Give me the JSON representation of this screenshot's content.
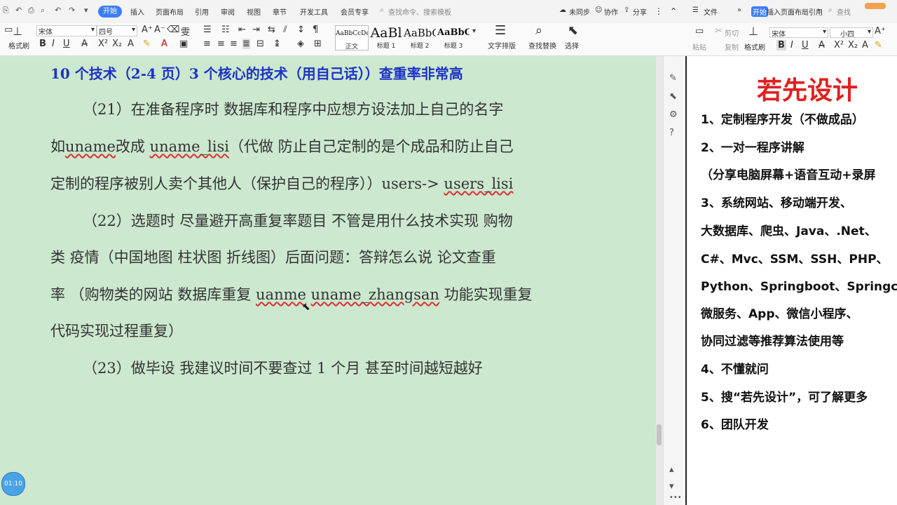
{
  "left_window": {
    "quick_access": [
      "⎘",
      "↶",
      "⎙",
      "⌕",
      "↶",
      "↷",
      "▾"
    ],
    "active_tab": "开始",
    "menu_tabs": [
      "插入",
      "页面布局",
      "引用",
      "审阅",
      "视图",
      "章节",
      "开发工具",
      "会员专享"
    ],
    "search_placeholder": "查找命令、搜索模板",
    "right_actions": [
      "未同步",
      "协作",
      "分享"
    ],
    "font_name": "宋体",
    "font_size": "四号",
    "format_painter": "格式刷",
    "styles": [
      {
        "preview": "AaBbCcDd",
        "label": "正文"
      },
      {
        "preview": "AaBl",
        "label": "标题 1"
      },
      {
        "preview": "AaBbC",
        "label": "标题 2"
      },
      {
        "preview": "AaBbC",
        "label": "标题 3"
      }
    ],
    "text_layout": "文字排版",
    "find_replace": "查找替换",
    "select": "选择",
    "timer": "01:10"
  },
  "document": {
    "heading": "10 个技术（2-4 页）3 个核心的技术（用自己话））查重率非常高",
    "l1": "（21）在准备程序时 数据库和程序中应想方设法加上自己的名字",
    "l2a": "如",
    "l2b": "uname",
    "l2c": "改成 ",
    "l2d": "uname_lisi",
    "l2e": "（代做 防止自己定制的是个成品和防止自己",
    "l3a": "定制的程序被别人卖个其他人（保护自己的程序））users-> ",
    "l3b": "users_lisi",
    "l4": "（22）选题时 尽量避开高重复率题目 不管是用什么技术实现 购物",
    "l5": "类 疫情（中国地图 柱状图 折线图）后面问题：答辩怎么说 论文查重",
    "l6a": "率 （购物类的网站 数据库重复 ",
    "l6b": "uanme",
    "l6c": " ",
    "l6d": "uname_zhangsan",
    "l6e": " 功能实现重复",
    "l7": "代码实现过程重复）",
    "l8": "（23）做毕设 我建议时间不要查过 1 个月 甚至时间越短越好"
  },
  "right_window": {
    "file_menu": "文件",
    "tabs_text": "插入页面布局引用",
    "active_tab": "开始",
    "search": "查找",
    "font_name": "宋体",
    "font_size": "小四",
    "paste": "粘贴",
    "cut": "剪切",
    "copy": "复制",
    "format_painter": "格式刷",
    "title": "若先设计",
    "lines": [
      "1、定制程序开发（不做成品）",
      "2、一对一程序讲解",
      "（分享电脑屏幕+语音互动+录屏",
      "3、系统网站、移动端开发、",
      "大数据库、爬虫、Java、.Net、",
      "C#、Mvc、SSM、SSH、PHP、",
      "Python、Springboot、Springclou",
      "微服务、App、微信小程序、",
      "协同过滤等推荐算法使用等",
      "4、不懂就问",
      "5、搜“若先设计”，可了解更多",
      "6、团队开发"
    ]
  }
}
